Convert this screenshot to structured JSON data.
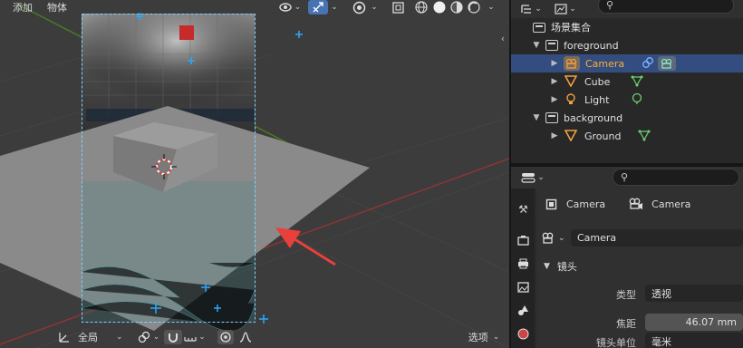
{
  "viewport": {
    "menu": {
      "add": "添加",
      "object": "物体"
    },
    "footer": {
      "orientation": "全局",
      "options": "选项"
    },
    "colors": {
      "background": "#3c3c3c",
      "plane": "#8a8a8a",
      "grid_x": "#8c3535",
      "grid_y": "#4a7a22",
      "empty": "#29a8ff",
      "annotation_arrow": "#e8403a"
    }
  },
  "outliner": {
    "header": {
      "search_placeholder": ""
    },
    "scene_collection": "场景集合",
    "items": [
      {
        "label": "foreground",
        "kind": "collection"
      },
      {
        "label": "Camera",
        "kind": "camera"
      },
      {
        "label": "Cube",
        "kind": "mesh"
      },
      {
        "label": "Light",
        "kind": "light"
      },
      {
        "label": "background",
        "kind": "collection"
      },
      {
        "label": "Ground",
        "kind": "mesh"
      }
    ]
  },
  "properties": {
    "breadcrumb": {
      "object": "Camera",
      "data": "Camera"
    },
    "datablock": "Camera",
    "panel_title": "镜头",
    "rows": {
      "type_label": "类型",
      "type_value": "透视",
      "focal_label": "焦距",
      "focal_value": "46.07 mm",
      "unit_label": "镜头单位",
      "unit_value": "毫米"
    }
  }
}
